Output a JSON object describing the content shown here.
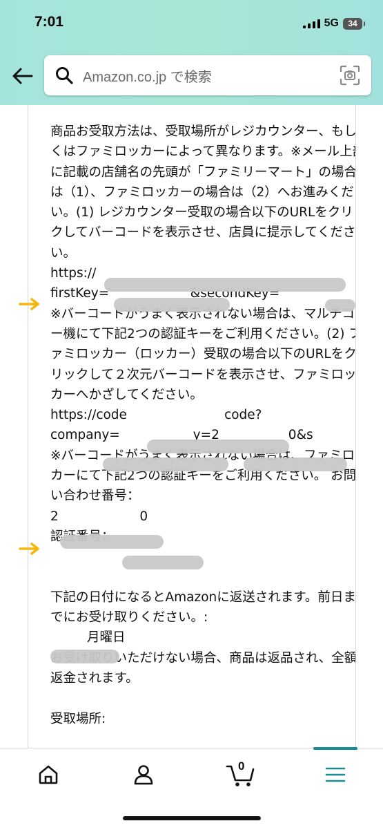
{
  "status_bar": {
    "time": "7:01",
    "network": "5G",
    "battery": "34"
  },
  "search": {
    "placeholder": "Amazon.co.jp で検索"
  },
  "message": {
    "text": "商品お受取方法は、受取場所がレジカウンター、もしくはファミロッカーによって異なります。※メール上部に記載の店舗名の先頭が「ファミリーマート」の場合は（1）、ファミロッカーの場合は（2）へお進みください。(1) レジカウンター受取の場合以下のURLをクリックしてバーコードを表示させ、店員に提示してください。\nhttps://\nfirstKey=                    &secondKey=\n※バーコードがうまく表示されない場合は、マルチコピー機にて下記2つの認証キーをご利用ください。(2) ファミロッカー（ロッカー）受取の場合以下のURLをクリックして２次元バーコードを表示させ、ファミロッカーへかざしてください。\nhttps://code                        code?\ncompany=                  y=2                 0&s\n※バーコードがうまく表示されない場合は、ファミロッカーにて下記2つの認証キーをご利用ください。 お問い合わせ番号：\n2                    0\n認証番号：\n\n\n下記の日付になるとAmazonに返送されます。前日までにお受け取りください。:\n         月曜日\nお受け取りいただけない場合、商品は返品され、全額返金されます。\n\n受取場所:"
  },
  "bottom_nav": {
    "items": [
      "home",
      "account",
      "cart",
      "menu"
    ],
    "cart_count": "0"
  },
  "colors": {
    "header_bg": "#a6e5da",
    "accent": "#1a8c93",
    "marker": "#f5b50a"
  }
}
